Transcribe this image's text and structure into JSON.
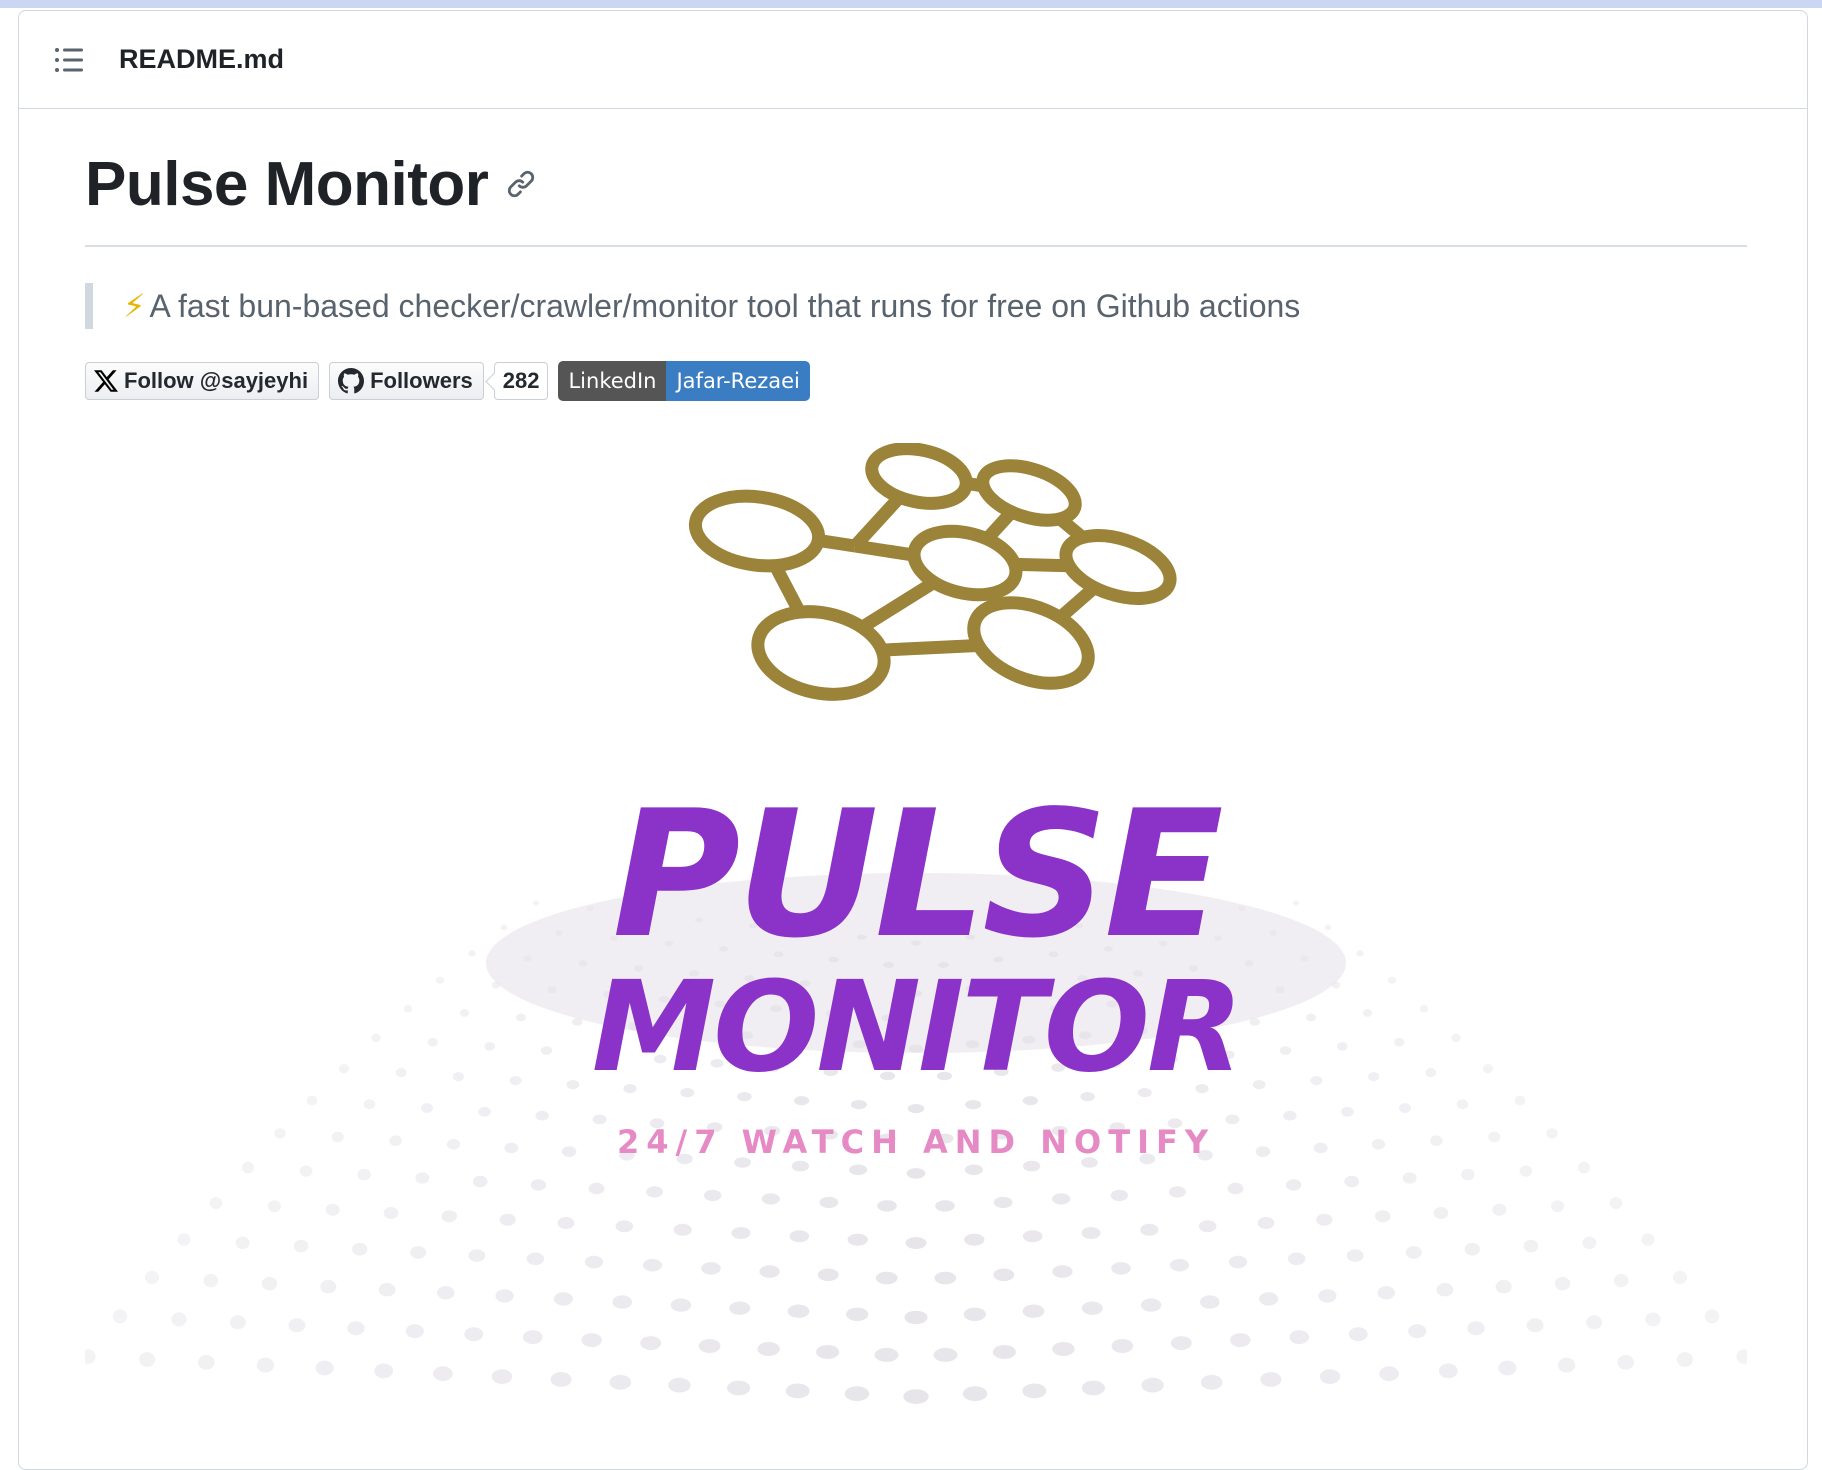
{
  "readme": {
    "file_name": "README.md",
    "title": "Pulse Monitor",
    "tagline_emoji": "⚡",
    "tagline": "A fast bun-based checker/crawler/monitor tool that runs for free on Github actions"
  },
  "badges": {
    "twitter_label": "Follow @sayjeyhi",
    "github_label": "Followers",
    "github_count": "282",
    "linkedin_left": "LinkedIn",
    "linkedin_right": "Jafar-Rezaei"
  },
  "logo": {
    "word1": "PULSE",
    "word2": "MONITOR",
    "tagline": "24/7 WATCH AND NOTIFY",
    "colors": {
      "network": "#9b8339",
      "text": "#8b32c8",
      "tagline": "#e58ac4",
      "dots": "#e4e2e8"
    }
  },
  "icons": {
    "toc": "list-icon",
    "anchor": "link-icon",
    "twitter": "x-logo-icon",
    "github": "github-mark-icon"
  }
}
